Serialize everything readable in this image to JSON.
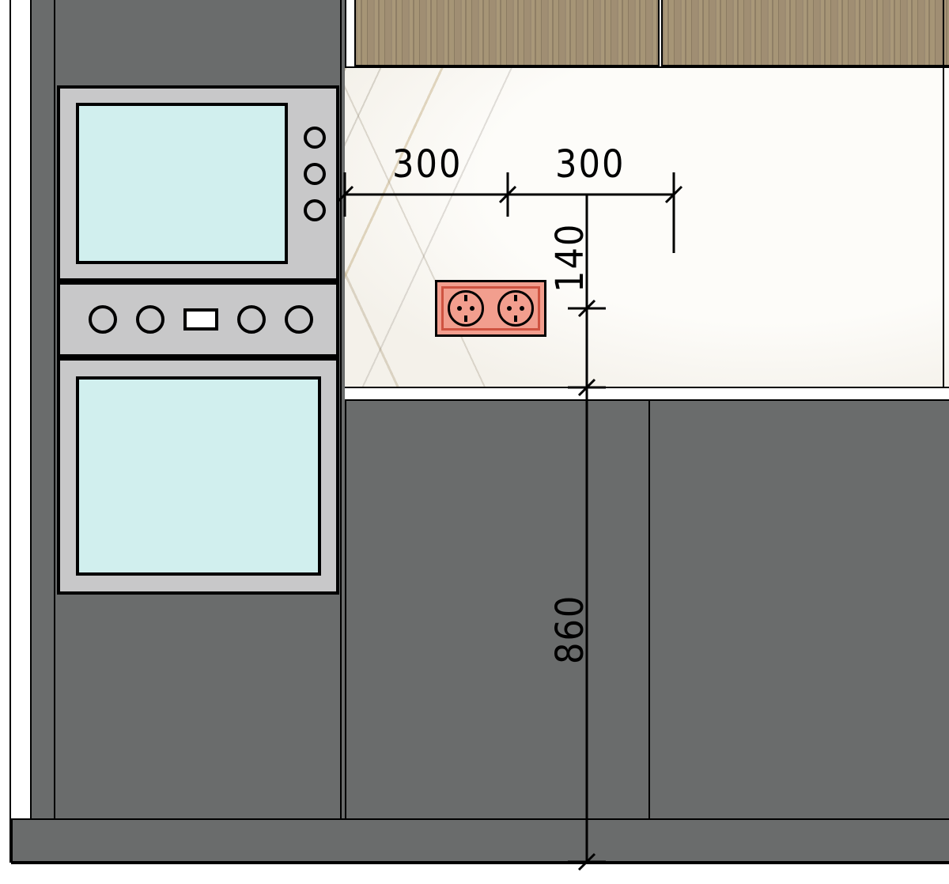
{
  "dimensions": {
    "h1": "300",
    "h2": "300",
    "v_small": "140",
    "v_large": "860"
  },
  "colors": {
    "cabinet": "#6a6c6c",
    "steel": "#c8c8c9",
    "glass": "#d1efee",
    "outlet": "#f29e8e",
    "outlet_accent": "#cf5341",
    "wood": "#a08e73",
    "marble": "#fbfaf7"
  },
  "elements": {
    "outlet": "double-euro-socket",
    "upper_appliance": "microwave",
    "lower_appliance": "oven"
  }
}
